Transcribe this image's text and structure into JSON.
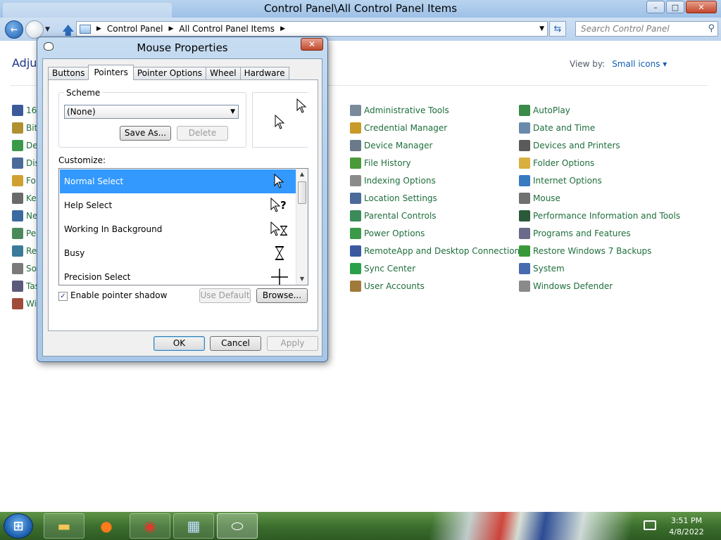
{
  "window": {
    "title": "Control Panel\\All Control Panel Items",
    "controls": {
      "minimize": "–",
      "maximize": "□",
      "close": "✕"
    }
  },
  "address": {
    "breadcrumbs": [
      "Control Panel",
      "All Control Panel Items"
    ],
    "search_placeholder": "Search Control Panel"
  },
  "content": {
    "heading_partial": "Adjus",
    "view_by_label": "View by:",
    "view_by_value": "Small icons ▾",
    "left_items_partial": [
      "16-",
      "Bit",
      "De",
      "Dis",
      "Fo",
      "Ke",
      "Ne",
      "Pe",
      "Re",
      "So",
      "Tas",
      "Wi"
    ],
    "column1": [
      {
        "label": "Administrative Tools",
        "color": "#7a8a9a"
      },
      {
        "label": "Credential Manager",
        "color": "#c89a2a"
      },
      {
        "label": "Device Manager",
        "color": "#6a7a8a"
      },
      {
        "label": "File History",
        "color": "#4a9a3a"
      },
      {
        "label": "Indexing Options",
        "color": "#8a8a8a"
      },
      {
        "label": "Location Settings",
        "color": "#4a6a9a"
      },
      {
        "label": "Parental Controls",
        "color": "#3a8a5a"
      },
      {
        "label": "Power Options",
        "color": "#3a9a4a"
      },
      {
        "label": "RemoteApp and Desktop Connections",
        "color": "#3a5aa0"
      },
      {
        "label": "Sync Center",
        "color": "#2aa04a"
      },
      {
        "label": "User Accounts",
        "color": "#a07a3a"
      }
    ],
    "column2": [
      {
        "label": "AutoPlay",
        "color": "#3a8a4a"
      },
      {
        "label": "Date and Time",
        "color": "#6a8aaa"
      },
      {
        "label": "Devices and Printers",
        "color": "#5a5a5a"
      },
      {
        "label": "Folder Options",
        "color": "#d8b040"
      },
      {
        "label": "Internet Options",
        "color": "#3a7ac0"
      },
      {
        "label": "Mouse",
        "color": "#707070"
      },
      {
        "label": "Performance Information and Tools",
        "color": "#2a5a3a"
      },
      {
        "label": "Programs and Features",
        "color": "#6a6a8a"
      },
      {
        "label": "Restore Windows 7 Backups",
        "color": "#3a9a3a"
      },
      {
        "label": "System",
        "color": "#4a6ab0"
      },
      {
        "label": "Windows Defender",
        "color": "#8a8a8a"
      }
    ]
  },
  "dialog": {
    "title": "Mouse Properties",
    "close": "✕",
    "tabs": [
      "Buttons",
      "Pointers",
      "Pointer Options",
      "Wheel",
      "Hardware"
    ],
    "active_tab": "Pointers",
    "scheme_label": "Scheme",
    "scheme_value": "(None)",
    "save_as": "Save As...",
    "delete": "Delete",
    "customize_label": "Customize:",
    "cursor_rows": [
      {
        "label": "Normal Select",
        "selected": true,
        "glyph": "arrow"
      },
      {
        "label": "Help Select",
        "selected": false,
        "glyph": "help"
      },
      {
        "label": "Working In Background",
        "selected": false,
        "glyph": "working"
      },
      {
        "label": "Busy",
        "selected": false,
        "glyph": "busy"
      },
      {
        "label": "Precision Select",
        "selected": false,
        "glyph": "cross"
      }
    ],
    "shadow_checkbox": {
      "label": "Enable pointer shadow",
      "checked": true,
      "mark": "✓"
    },
    "use_default": "Use Default",
    "browse": "Browse...",
    "ok": "OK",
    "cancel": "Cancel",
    "apply": "Apply"
  },
  "taskbar": {
    "time": "3:51 PM",
    "date": "4/8/2022",
    "apps": [
      "windows-explorer",
      "firefox",
      "chrome",
      "control-panel",
      "mouse-properties"
    ]
  }
}
